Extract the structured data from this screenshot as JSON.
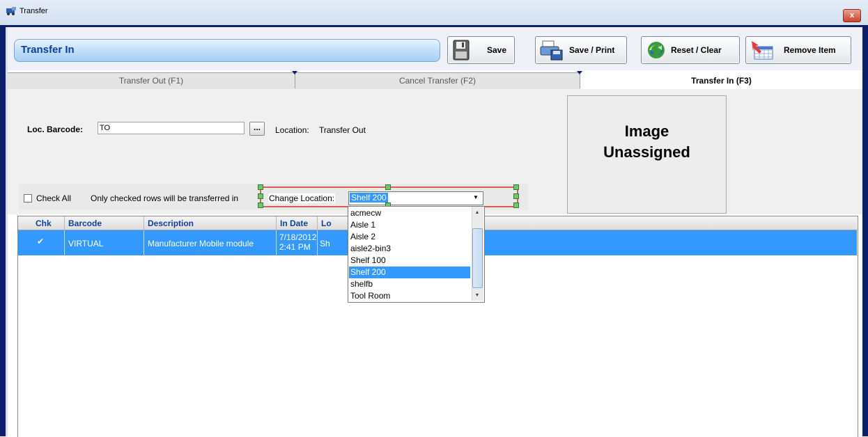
{
  "window": {
    "title": "Transfer",
    "close_symbol": "x"
  },
  "header": {
    "banner_title": "Transfer In",
    "buttons": {
      "save": "Save",
      "save_print": "Save / Print",
      "reset_clear": "Reset / Clear",
      "remove_item": "Remove Item"
    }
  },
  "tabs": [
    {
      "label": "Transfer Out (F1)",
      "active": false
    },
    {
      "label": "Cancel Transfer (F2)",
      "active": false
    },
    {
      "label": "Transfer In (F3)",
      "active": true
    }
  ],
  "form": {
    "loc_barcode_label": "Loc. Barcode:",
    "loc_barcode_value": "TO",
    "browse_label": "...",
    "location_label": "Location:",
    "location_value": "Transfer Out",
    "image_placeholder_line1": "Image",
    "image_placeholder_line2": "Unassigned",
    "check_all_label": "Check All",
    "note": "Only checked rows will be transferred in",
    "change_location_label": "Change Location:",
    "change_location_selected": "Shelf 200"
  },
  "grid": {
    "columns": [
      "Chk",
      "Barcode",
      "Description",
      "In Date",
      "Lo"
    ],
    "rows": [
      {
        "checked": true,
        "check_mark": "✔",
        "barcode": "VIRTUAL",
        "description": "Manufacturer Mobile module",
        "in_date_line1": "7/18/2012",
        "in_date_line2": "2:41 PM",
        "location_partial": "Sh"
      }
    ]
  },
  "dropdown": {
    "options": [
      "acmecw",
      "Aisle 1",
      "Aisle 2",
      "aisle2-bin3",
      "Shelf 100",
      "Shelf 200",
      "shelfb",
      "Tool Room"
    ],
    "selected_index": 5
  },
  "colors": {
    "frame": "#0b1f6b",
    "selection": "#3399ff",
    "header_text": "#0e3f9a",
    "design_outline": "#e05a5a",
    "design_handle": "#6ec76e"
  },
  "icons": [
    "app-icon",
    "floppy-disk-icon",
    "printer-icon",
    "refresh-icon",
    "remove-item-icon",
    "scroll-up-icon",
    "scroll-down-icon",
    "dropdown-arrow-icon"
  ]
}
